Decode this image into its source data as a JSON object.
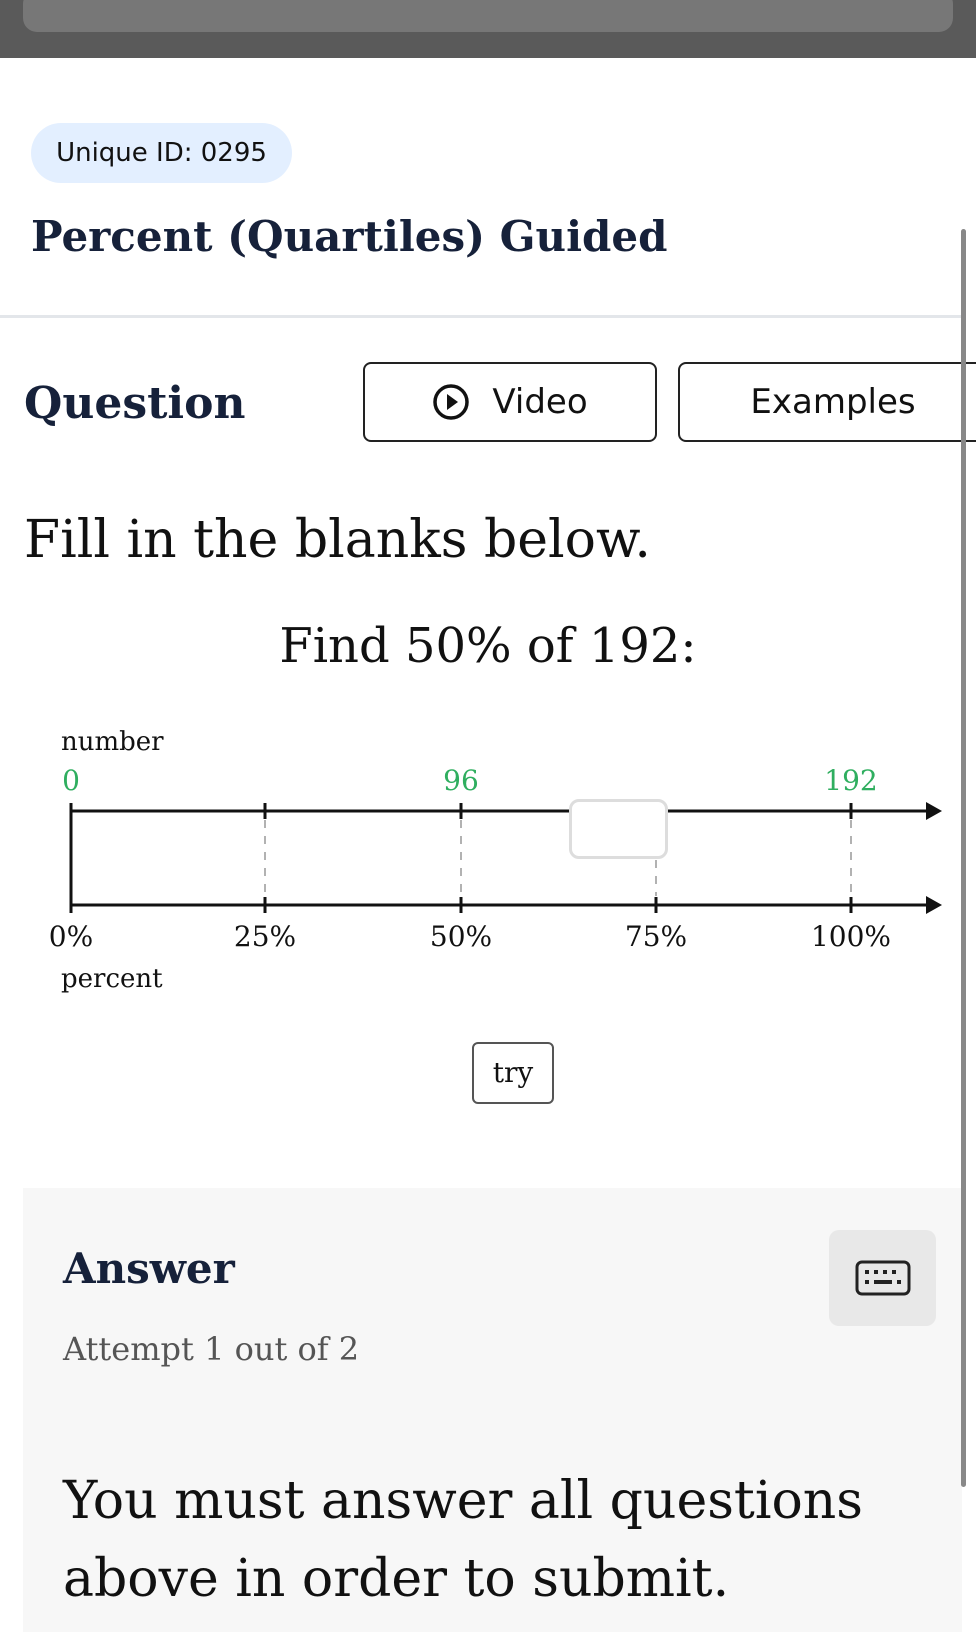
{
  "browser": {
    "url": "deltamath.com"
  },
  "header": {
    "unique_id": "Unique ID: 0295",
    "title": "Percent (Quartiles) Guided"
  },
  "question": {
    "heading": "Question",
    "video_label": "Video",
    "video_icon": "play-circle-icon",
    "examples_label": "Examples",
    "instruction": "Fill in the blanks below.",
    "prompt": "Find 50% of 192:"
  },
  "number_line": {
    "top_label": "number",
    "bottom_label": "percent",
    "number_labels": [
      "0",
      "96",
      "192"
    ],
    "percent_labels": [
      "0%",
      "25%",
      "50%",
      "75%",
      "100%"
    ],
    "blank_input_value": "",
    "number_color": "#2fae5f",
    "try_label": "try"
  },
  "answer": {
    "heading": "Answer",
    "keyboard_icon": "keyboard-icon",
    "attempt": "Attempt 1 out of 2",
    "message": "You must answer all questions above in order to submit."
  }
}
